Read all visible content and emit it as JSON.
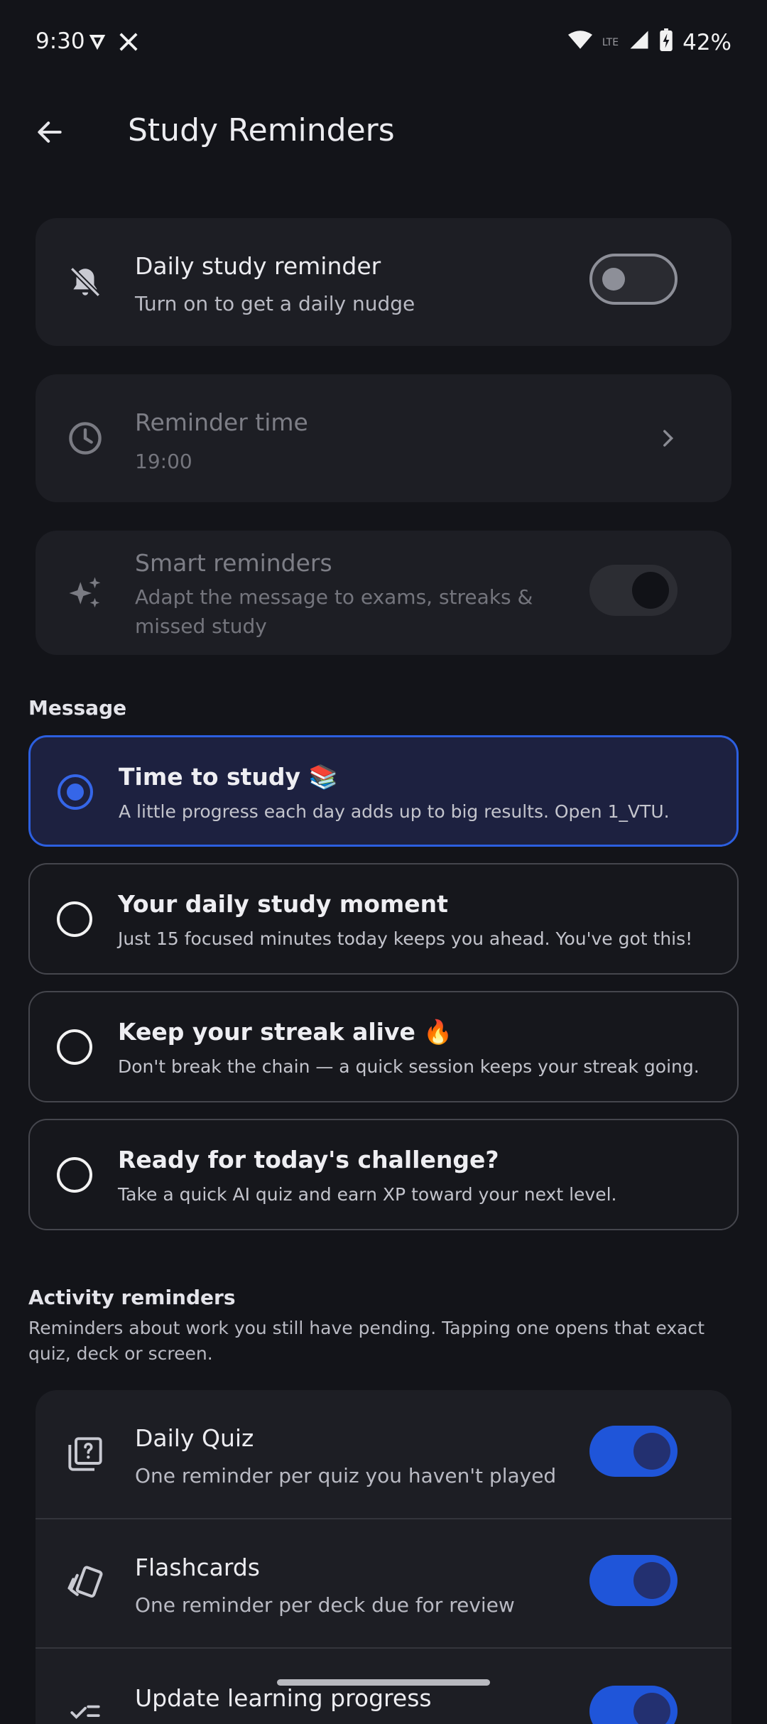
{
  "status_bar": {
    "time": "9:30",
    "battery": "42%"
  },
  "app_bar": {
    "title": "Study Reminders"
  },
  "daily": {
    "title": "Daily study reminder",
    "subtitle": "Turn on to get a daily nudge",
    "enabled": false
  },
  "reminder_time": {
    "title": "Reminder time",
    "value": "19:00"
  },
  "smart": {
    "title": "Smart reminders",
    "subtitle_line1": "Adapt the message to exams, streaks &",
    "subtitle_line2": "missed study",
    "enabled": false
  },
  "message": {
    "header": "Message",
    "options": [
      {
        "title": "Time to study 📚",
        "subtitle": "A little progress each day adds up to big results. Open 1_VTU.",
        "selected": true
      },
      {
        "title": "Your daily study moment",
        "subtitle": "Just 15 focused minutes today keeps you ahead. You've got this!",
        "selected": false
      },
      {
        "title": "Keep your streak alive 🔥",
        "subtitle": "Don't break the chain — a quick session keeps your streak going.",
        "selected": false
      },
      {
        "title": "Ready for today's challenge?",
        "subtitle": "Take a quick AI quiz and earn XP toward your next level.",
        "selected": false
      }
    ]
  },
  "activity": {
    "header": "Activity reminders",
    "description": "Reminders about work you still have pending. Tapping one opens that exact quiz, deck or screen.",
    "items": [
      {
        "title": "Daily Quiz",
        "subtitle": "One reminder per quiz you haven't played",
        "enabled": true
      },
      {
        "title": "Flashcards",
        "subtitle": "One reminder per deck due for review",
        "enabled": true
      },
      {
        "title": "Update learning progress",
        "enabled": true
      }
    ]
  }
}
